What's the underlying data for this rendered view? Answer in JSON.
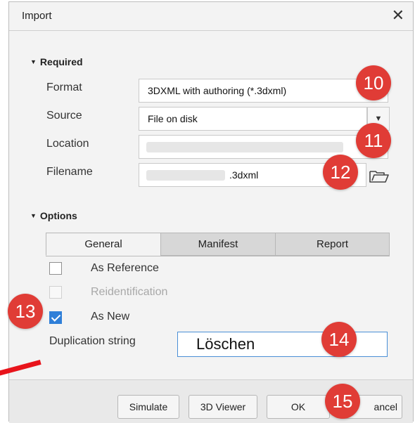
{
  "window": {
    "title": "Import",
    "close_glyph": "✕"
  },
  "required": {
    "header": "Required",
    "format": {
      "label": "Format",
      "value": "3DXML with authoring (*.3dxml)"
    },
    "source": {
      "label": "Source",
      "value": "File on disk"
    },
    "location": {
      "label": "Location",
      "value": ""
    },
    "filename": {
      "label": "Filename",
      "value": ".3dxml"
    }
  },
  "options": {
    "header": "Options",
    "tabs": [
      {
        "label": "General",
        "active": true
      },
      {
        "label": "Manifest",
        "active": false
      },
      {
        "label": "Report",
        "active": false
      }
    ],
    "checkboxes": [
      {
        "label": "As Reference",
        "checked": false,
        "enabled": true
      },
      {
        "label": "Reidentification",
        "checked": false,
        "enabled": false
      },
      {
        "label": "As New",
        "checked": true,
        "enabled": true
      }
    ],
    "duplication": {
      "label": "Duplication string",
      "value": "Löschen"
    }
  },
  "buttons": {
    "simulate": "Simulate",
    "viewer": "3D Viewer",
    "ok": "OK",
    "cancel": "ancel"
  },
  "badges": {
    "b10": "10",
    "b11": "11",
    "b12": "12",
    "b13": "13",
    "b14": "14",
    "b15": "15"
  },
  "colors": {
    "badge": "#e03c36",
    "checkbox_accent": "#2f7fd8",
    "annotation_line": "#e8141b"
  }
}
